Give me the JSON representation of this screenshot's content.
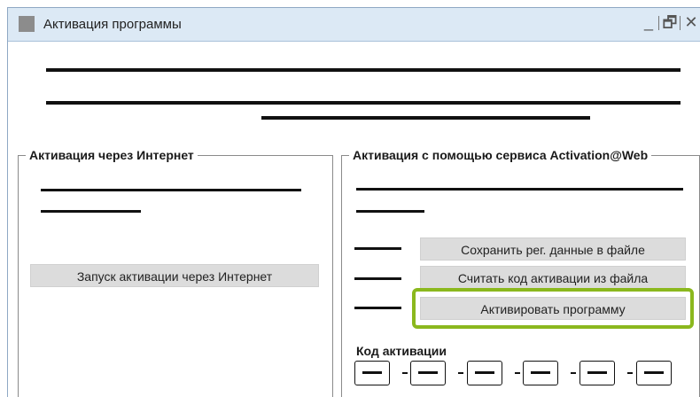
{
  "window": {
    "title": "Активация программы",
    "controls": {
      "minimize": "_",
      "restore": "🗗",
      "close": "✕"
    }
  },
  "internet_group": {
    "legend": "Активация через Интернет",
    "start_button": "Запуск активации через Интернет"
  },
  "web_group": {
    "legend": "Активация с помощью сервиса Activation@Web",
    "save_button": "Сохранить рег. данные в файле",
    "read_button": "Считать код активации из файла",
    "activate_button": "Активировать программу",
    "code_label": "Код активации",
    "highlight_color": "#8bb81e"
  }
}
